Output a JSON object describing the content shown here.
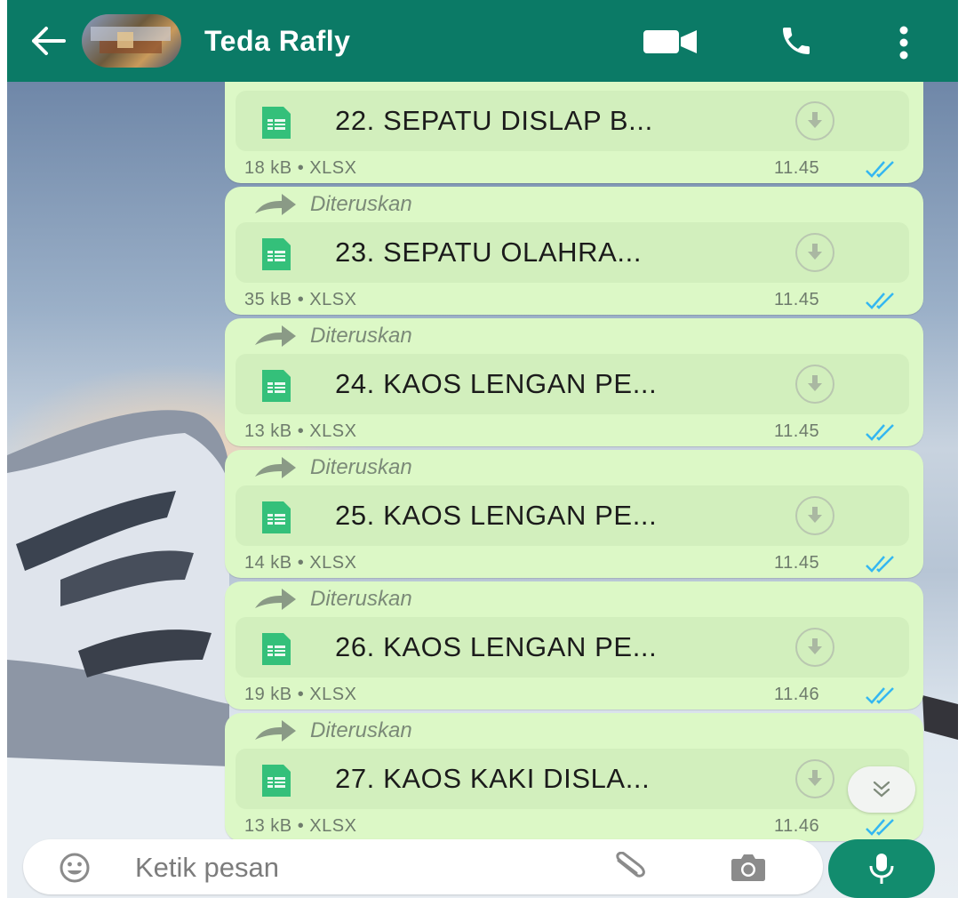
{
  "header": {
    "contact_name": "Teda Rafly",
    "color": "#0b7a66"
  },
  "messages": [
    {
      "forwarded": false,
      "forward_label": "",
      "file_name": "22. SEPATU DISLAP B...",
      "size": "18 kB",
      "type": "XLSX",
      "time": "11.45"
    },
    {
      "forwarded": true,
      "forward_label": "Diteruskan",
      "file_name": "23. SEPATU OLAHRA...",
      "size": "35 kB",
      "type": "XLSX",
      "time": "11.45"
    },
    {
      "forwarded": true,
      "forward_label": "Diteruskan",
      "file_name": "24. KAOS LENGAN PE...",
      "size": "13 kB",
      "type": "XLSX",
      "time": "11.45"
    },
    {
      "forwarded": true,
      "forward_label": "Diteruskan",
      "file_name": "25. KAOS LENGAN PE...",
      "size": "14 kB",
      "type": "XLSX",
      "time": "11.45"
    },
    {
      "forwarded": true,
      "forward_label": "Diteruskan",
      "file_name": "26. KAOS LENGAN PE...",
      "size": "19 kB",
      "type": "XLSX",
      "time": "11.46"
    },
    {
      "forwarded": true,
      "forward_label": "Diteruskan",
      "file_name": "27. KAOS KAKI DISLA...",
      "size": "13 kB",
      "type": "XLSX",
      "time": "11.46"
    }
  ],
  "composer": {
    "placeholder": "Ketik pesan"
  },
  "icons": {
    "back": "arrow-left-icon",
    "video": "video-camera-icon",
    "call": "phone-icon",
    "menu": "more-vertical-icon",
    "file": "spreadsheet-icon",
    "download": "download-icon",
    "read_status": "double-check-icon",
    "emoji": "emoji-icon",
    "attach": "paperclip-icon",
    "camera": "camera-icon",
    "mic": "microphone-icon",
    "scroll": "double-chevron-down-icon"
  },
  "colors": {
    "bubble": "#dcf8c6",
    "read_tick": "#34b7f1",
    "file_icon": "#34c07a",
    "mic_button": "#128c6e"
  }
}
